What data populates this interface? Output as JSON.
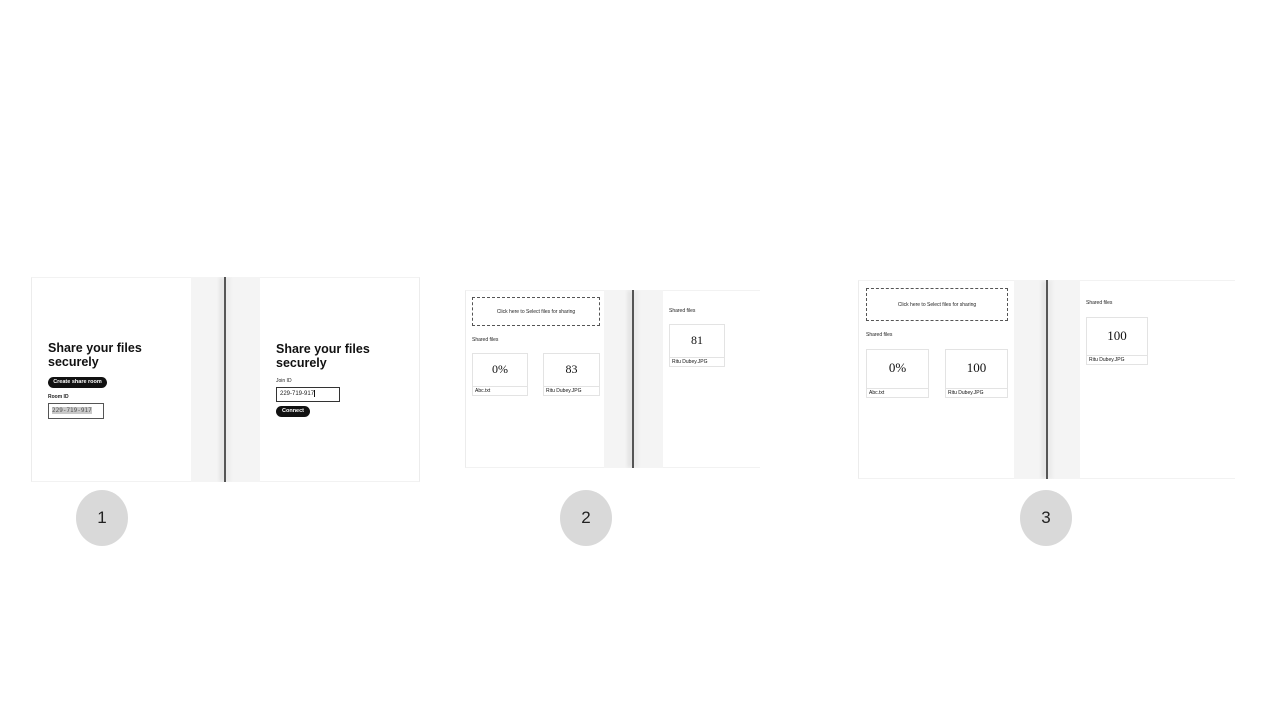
{
  "step1": {
    "left": {
      "heading_line1": "Share your files",
      "heading_line2": "securely",
      "create_button": "Create share room",
      "room_id_label": "Room ID",
      "room_id_value": "229-719-917"
    },
    "right": {
      "heading_line1": "Share your files",
      "heading_line2": "securely",
      "join_id_label": "Join ID",
      "join_id_value": "229-719-917",
      "connect_button": "Connect"
    },
    "step_number": "1"
  },
  "step2": {
    "left": {
      "dropzone_text": "Click here to Select files for sharing",
      "shared_files_label": "Shared files",
      "files": [
        {
          "progress": "0%",
          "name": "Abc.txt"
        },
        {
          "progress": "83",
          "name": "Ritu Dubey.JPG"
        }
      ]
    },
    "right": {
      "shared_files_label": "Shared files",
      "files": [
        {
          "progress": "81",
          "name": "Ritu Dubey.JPG"
        }
      ]
    },
    "step_number": "2"
  },
  "step3": {
    "left": {
      "dropzone_text": "Click here to Select files for sharing",
      "shared_files_label": "Shared files",
      "files": [
        {
          "progress": "0%",
          "name": "Abc.txt"
        },
        {
          "progress": "100",
          "name": "Ritu Dubey.JPG"
        }
      ]
    },
    "right": {
      "shared_files_label": "Shared files",
      "files": [
        {
          "progress": "100",
          "name": "Ritu Dubey.JPG"
        }
      ]
    },
    "step_number": "3"
  },
  "colors": {
    "button_bg": "#111111",
    "divider_bg": "#f4f4f4",
    "step_circle": "#d9d9d9"
  }
}
